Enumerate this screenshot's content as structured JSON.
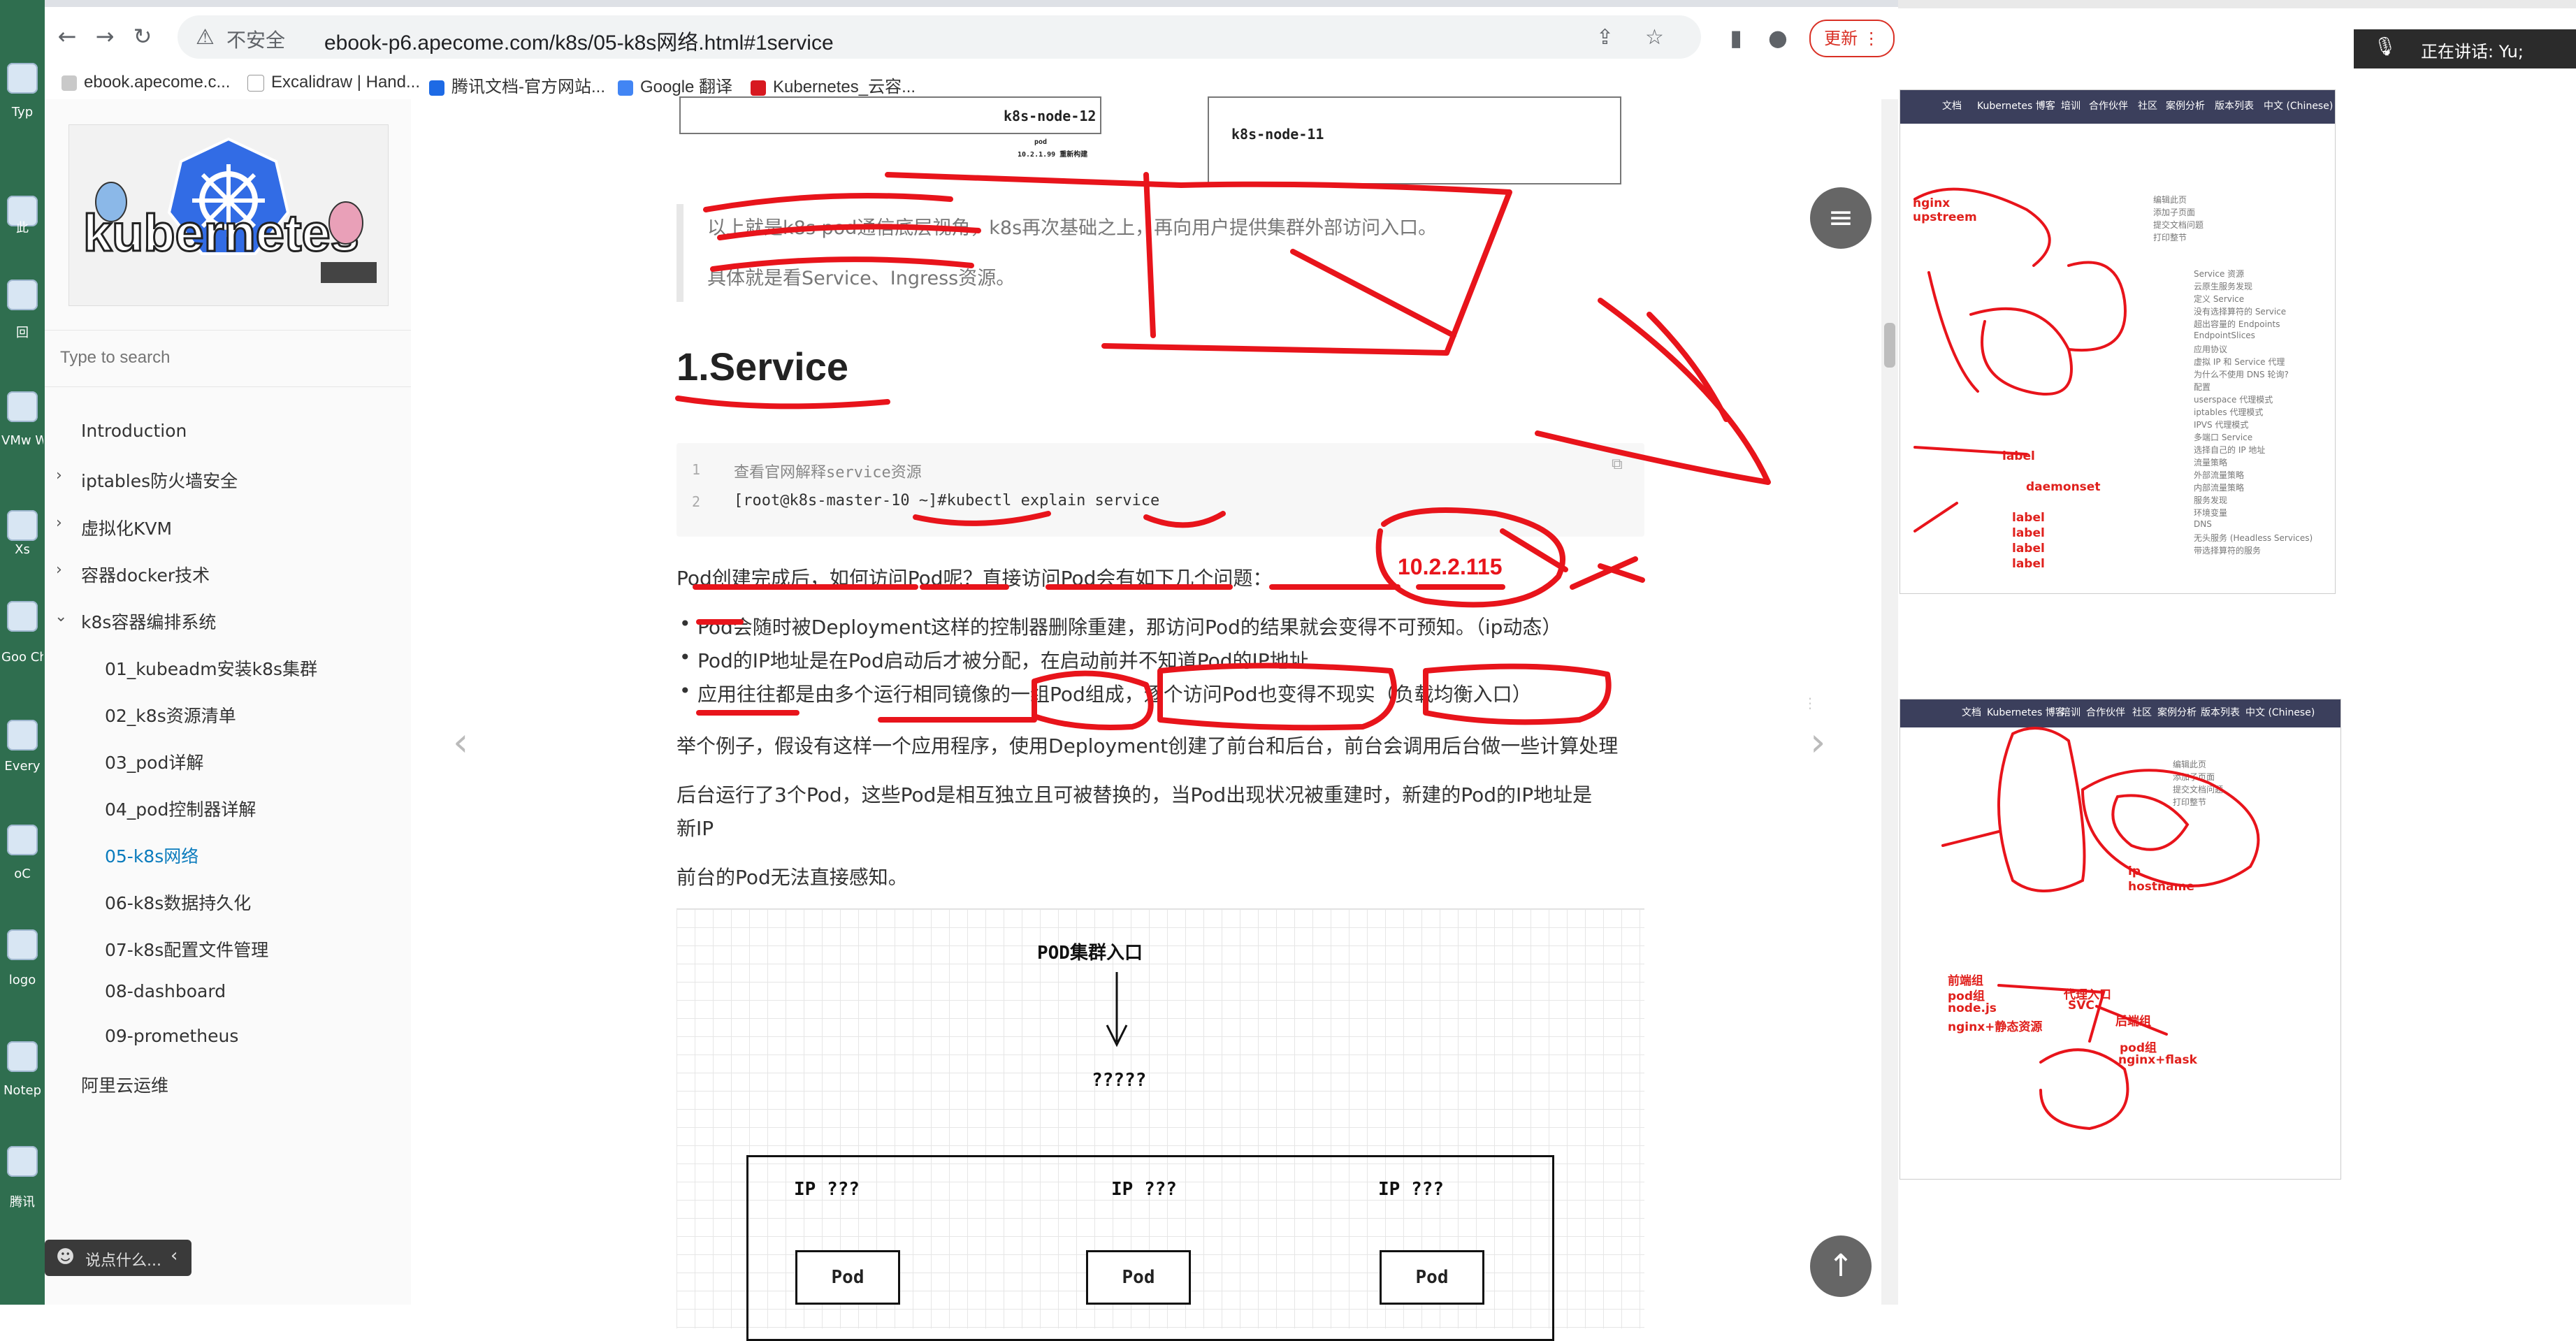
{
  "desktop": {
    "icons": [
      "Typ",
      "此",
      "回",
      "VMw Work",
      "Xs",
      "Goo Chr",
      "Every",
      "oC",
      "logo",
      "Notep",
      "腾讯"
    ]
  },
  "browser": {
    "insecure_label": "不安全",
    "url": "ebook-p6.apecome.com/k8s/05-k8s网络.html#1service",
    "update_label": "更新",
    "bookmarks": [
      "ebook.apecome.c...",
      "Excalidraw | Hand...",
      "腾讯文档-官方网站...",
      "Google 翻译",
      "Kubernetes_云容..."
    ]
  },
  "sidebar": {
    "search_placeholder": "Type to search",
    "items": [
      {
        "label": "Introduction"
      },
      {
        "label": "iptables防火墙安全"
      },
      {
        "label": "虚拟化KVM"
      },
      {
        "label": "容器docker技术"
      },
      {
        "label": "k8s容器编排系统"
      },
      {
        "label": "01_kubeadm安装k8s集群"
      },
      {
        "label": "02_k8s资源清单"
      },
      {
        "label": "03_pod详解"
      },
      {
        "label": "04_pod控制器详解"
      },
      {
        "label": "05-k8s网络"
      },
      {
        "label": "06-k8s数据持久化"
      },
      {
        "label": "07-k8s配置文件管理"
      },
      {
        "label": "08-dashboard"
      },
      {
        "label": "09-prometheus"
      },
      {
        "label": "阿里云运维"
      }
    ],
    "chat_placeholder": "说点什么..."
  },
  "article": {
    "top_image": {
      "node12": "k8s-node-12",
      "node11": "k8s-node-11",
      "pod_caption": "pod",
      "pod_ip": "10.2.1.99 重新构建"
    },
    "quote_1": "以上就是k8s pod通信底层视角，k8s再次基础之上，再向用户提供集群外部访问入口。",
    "quote_2": "具体就是看Service、Ingress资源。",
    "heading": "1.Service",
    "code": {
      "lines": [
        {
          "n": "1",
          "text": "查看官网解释service资源"
        },
        {
          "n": "2",
          "text": "[root@k8s-master-10 ~]#kubectl explain service"
        }
      ]
    },
    "para_1": "Pod创建完成后，如何访问Pod呢？直接访问Pod会有如下几个问题：",
    "bullets": [
      "Pod会随时被Deployment这样的控制器删除重建，那访问Pod的结果就会变得不可预知。（ip动态）",
      "Pod的IP地址是在Pod启动后才被分配，在启动前并不知道Pod的IP地址",
      "应用往往都是由多个运行相同镜像的一组Pod组成，逐个访问Pod也变得不现实（负载均衡入口）"
    ],
    "para_2": "举个例子，假设有这样一个应用程序，使用Deployment创建了前台和后台，前台会调用后台做一些计算处理",
    "para_3a": "后台运行了3个Pod，这些Pod是相互独立且可被替换的，当Pod出现状况被重建时，新建的Pod的IP地址是",
    "para_3b": "新IP",
    "para_4": "前台的Pod无法直接感知。",
    "diagram": {
      "entry": "POD集群入口",
      "unknown": "?????",
      "ip_labels": [
        "IP ???",
        "IP ???",
        "IP ???"
      ],
      "pod_labels": [
        "Pod",
        "Pod",
        "Pod"
      ]
    }
  },
  "annotations": {
    "ip_note": "10.2.2.115"
  },
  "meeting": {
    "speaking": "正在讲话: Yu;",
    "panel_1": {
      "nav": [
        "文档",
        "Kubernetes 博客",
        "培训",
        "合作伙伴",
        "社区",
        "案例分析",
        "版本列表",
        "中文 (Chinese)"
      ],
      "links": [
        "编辑此页",
        "添加子页面",
        "提交文档问题",
        "打印整节"
      ],
      "toc": [
        "Service 资源",
        "云原生服务发现",
        "定义 Service",
        "没有选择算符的 Service",
        "超出容量的 Endpoints",
        "EndpointSlices",
        "应用协议",
        "虚拟 IP 和 Service 代理",
        "为什么不使用 DNS 轮询?",
        "配置",
        "userspace 代理模式",
        "iptables 代理模式",
        "IPVS 代理模式",
        "多端口 Service",
        "选择自己的 IP 地址",
        "流量策略",
        "外部流量策略",
        "内部流量策略",
        "服务发现",
        "环境变量",
        "DNS",
        "无头服务 (Headless Services)",
        "带选择算符的服务"
      ],
      "ink_labels": [
        "nginx",
        "upstreem",
        "label",
        "daemonset",
        "label",
        "label",
        "label",
        "label"
      ]
    },
    "panel_2": {
      "nav": [
        "文档",
        "Kubernetes 博客",
        "培训",
        "合作伙伴",
        "社区",
        "案例分析",
        "版本列表",
        "中文 (Chinese)"
      ],
      "links": [
        "编辑此页",
        "添加子页面",
        "提交文档问题",
        "打印整节"
      ],
      "ink_labels": [
        "ip",
        "hostname",
        "前端组",
        "pod组",
        "node.js",
        "nginx+静态资源",
        "代理入口",
        "SVC",
        "后端组",
        "pod组",
        "nginx+flask"
      ]
    }
  },
  "colors": {
    "ink": "#e8141b",
    "accent": "#0a7bbd"
  }
}
